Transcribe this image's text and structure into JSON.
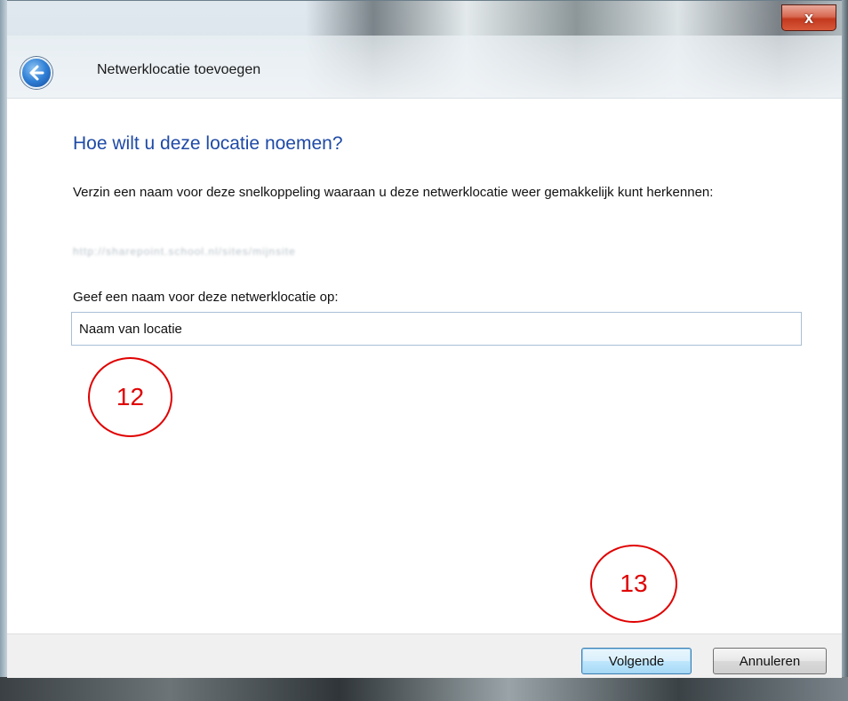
{
  "window": {
    "title": "Netwerklocatie toevoegen",
    "close_label": "x"
  },
  "main": {
    "heading": "Hoe wilt u deze locatie noemen?",
    "description": "Verzin een naam voor deze snelkoppeling waaraan u deze netwerklocatie weer gemakkelijk kunt herkennen:",
    "location_url": "http://sharepoint.school.nl/sites/mijnsite",
    "name_label": "Geef een naam voor deze netwerklocatie op:",
    "name_value": "Naam van locatie"
  },
  "annotations": {
    "step_12": "12",
    "step_13": "13"
  },
  "footer": {
    "next_label": "Volgende",
    "cancel_label": "Annuleren"
  },
  "colors": {
    "heading": "#1f4aa6",
    "annotation": "#e00000",
    "close_button": "#c2391e"
  }
}
